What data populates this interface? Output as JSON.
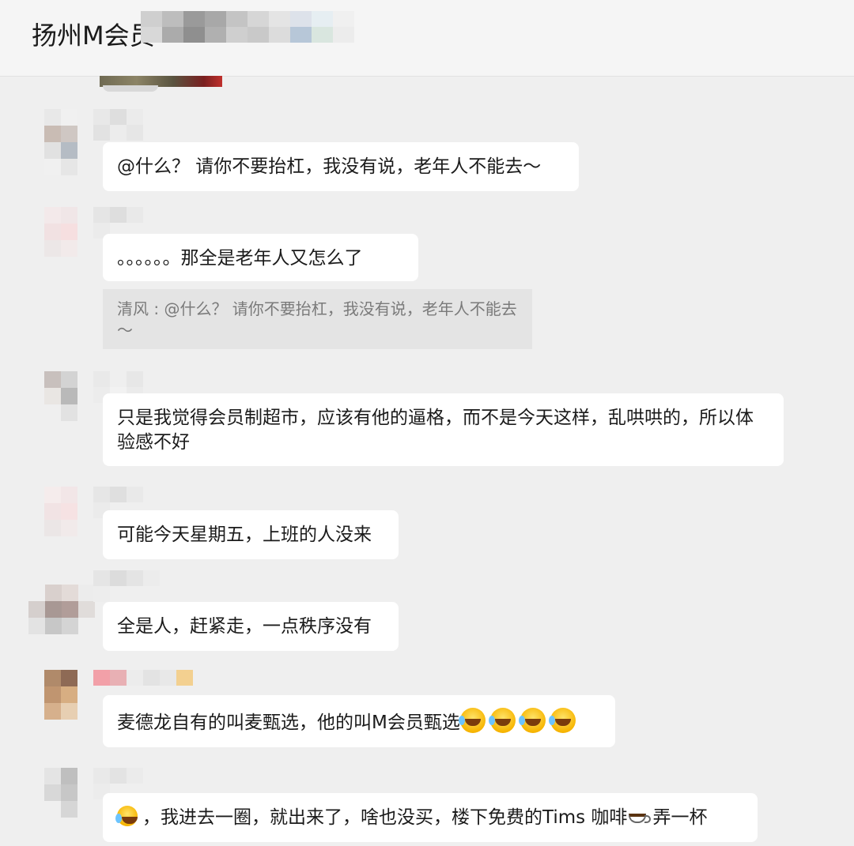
{
  "header": {
    "title": "扬州M会员"
  },
  "messages": [
    {
      "text": "@什么？ 请你不要抬杠，我没有说，老年人不能去～"
    },
    {
      "text": "。。。。。。那全是老年人又怎么了",
      "quote": "清风 : @什么？ 请你不要抬杠，我没有说，老年人不能去～"
    },
    {
      "text": "只是我觉得会员制超市，应该有他的逼格，而不是今天这样，乱哄哄的，所以体验感不好"
    },
    {
      "text": "可能今天星期五，上班的人没来"
    },
    {
      "text": "全是人，赶紧走，一点秩序没有"
    },
    {
      "text": "麦德龙自有的叫麦甄选，他的叫M会员甄选",
      "emoji": [
        "loudly-crying-face-icon",
        "loudly-crying-face-icon",
        "loudly-crying-face-icon",
        "loudly-crying-face-icon"
      ]
    },
    {
      "text_a": "，我进去一圈，就出来了，啥也没买，楼下免费的Tims 咖啡",
      "text_b": "弄一杯",
      "emoji_lead": "tears-of-joy-icon",
      "inline_icon": "coffee-icon"
    }
  ]
}
